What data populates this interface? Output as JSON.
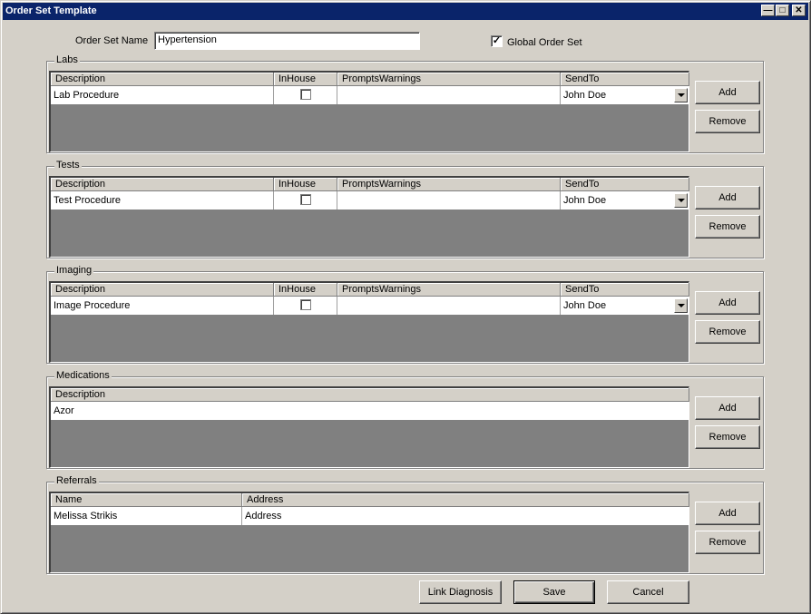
{
  "window": {
    "title": "Order Set Template"
  },
  "form": {
    "order_set_name_label": "Order Set Name",
    "order_set_name_value": "Hypertension",
    "global_label": "Global Order Set",
    "global_checked": true
  },
  "labs": {
    "title": "Labs",
    "columns": [
      "Description",
      "InHouse",
      "PromptsWarnings",
      "SendTo"
    ],
    "rows": [
      {
        "description": "Lab Procedure",
        "inhouse": false,
        "prompts": "",
        "sendto": "John Doe"
      }
    ],
    "add": "Add",
    "remove": "Remove"
  },
  "tests": {
    "title": "Tests",
    "columns": [
      "Description",
      "InHouse",
      "PromptsWarnings",
      "SendTo"
    ],
    "rows": [
      {
        "description": "Test Procedure",
        "inhouse": false,
        "prompts": "",
        "sendto": "John Doe"
      }
    ],
    "add": "Add",
    "remove": "Remove"
  },
  "imaging": {
    "title": "Imaging",
    "columns": [
      "Description",
      "InHouse",
      "PromptsWarnings",
      "SendTo"
    ],
    "rows": [
      {
        "description": "Image Procedure",
        "inhouse": false,
        "prompts": "",
        "sendto": "John Doe"
      }
    ],
    "add": "Add",
    "remove": "Remove"
  },
  "medications": {
    "title": "Medications",
    "columns": [
      "Description"
    ],
    "rows": [
      {
        "description": "Azor"
      }
    ],
    "add": "Add",
    "remove": "Remove"
  },
  "referrals": {
    "title": "Referrals",
    "columns": [
      "Name",
      "Address"
    ],
    "rows": [
      {
        "name": "Melissa Strikis",
        "address": "Address"
      }
    ],
    "add": "Add",
    "remove": "Remove"
  },
  "footer": {
    "link_diagnosis": "Link Diagnosis",
    "save": "Save",
    "cancel": "Cancel"
  }
}
